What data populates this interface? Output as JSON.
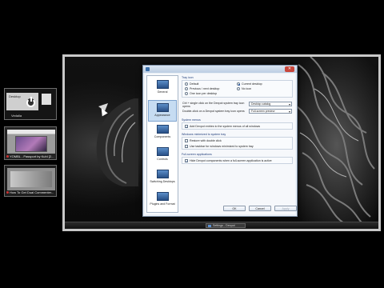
{
  "switcher": {
    "desktop1_tile_label": "Desktop",
    "desktop1_caption": "Vedalia",
    "desktop2_caption": "YOMBL - Passport by Kuhl [2...",
    "desktop3_caption": "How To Get Dual Commenter..."
  },
  "dialog": {
    "close_glyph": "✕",
    "nav": [
      {
        "label": "General",
        "icon": "monitor-icon"
      },
      {
        "label": "Appearance",
        "icon": "appearance-icon"
      },
      {
        "label": "Components",
        "icon": "components-icon"
      },
      {
        "label": "Controls",
        "icon": "controls-icon"
      },
      {
        "label": "Switching Desktops",
        "icon": "switching-icon"
      },
      {
        "label": "Plugins and Format",
        "icon": "plugins-icon"
      }
    ],
    "tray_icon": {
      "heading": "Tray icon",
      "opt_default": "Default",
      "opt_current": "Current desktop",
      "opt_prev_next": "Previous / next desktop",
      "opt_no_icon": "No icon",
      "opt_one_icon": "One icon per desktop"
    },
    "click_rows": {
      "single_label": "Ctrl + single click on the Dexpot system tray icon opens",
      "single_value": "Desktop catalog",
      "double_label": "Double-click on a Dexpot system tray icon opens",
      "double_value": "Full-screen preview"
    },
    "system_menus": {
      "heading": "System menus",
      "opt": "Add Dexpot entries to the system menus of all windows"
    },
    "minimized": {
      "heading": "Windows minimized to system tray",
      "opt1": "Restore with double click",
      "opt2": "Use taskbar for windows minimized to system tray"
    },
    "fullscreen": {
      "heading": "Full-screen applications",
      "opt": "Hide Dexpot components when a full-screen application is active"
    },
    "buttons": {
      "ok": "OK",
      "cancel": "Cancel",
      "apply": "Apply"
    }
  },
  "taskbar": {
    "task_label": "Settings - Dexpot"
  }
}
